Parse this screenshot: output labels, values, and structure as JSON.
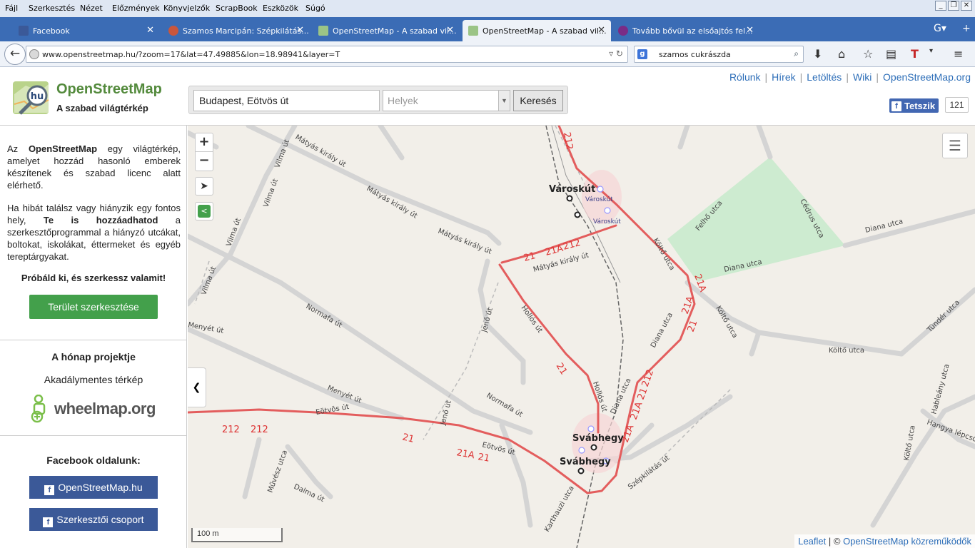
{
  "browser": {
    "menu": [
      {
        "label": "Fájl"
      },
      {
        "label": "Szerkesztés"
      },
      {
        "label": "Nézet"
      },
      {
        "label": "Előzmények"
      },
      {
        "label": "Könyvjelzők"
      },
      {
        "label": "ScrapBook"
      },
      {
        "label": "Eszközök"
      },
      {
        "label": "Súgó"
      }
    ],
    "tabs": [
      {
        "label": "Facebook",
        "icon": "facebook-icon",
        "active": false
      },
      {
        "label": "Szamos Marcipán: Szépkilátás...",
        "icon": "szamos-icon",
        "active": false
      },
      {
        "label": "OpenStreetMap - A szabad vil...",
        "icon": "osm-icon",
        "active": false
      },
      {
        "label": "OpenStreetMap - A szabad vil...",
        "icon": "osm-icon",
        "active": true
      },
      {
        "label": "Tovább bővül az elsőajtós fel...",
        "icon": "generic-page-icon",
        "active": false
      }
    ],
    "url": "www.openstreetmap.hu/?zoom=17&lat=47.49885&lon=18.98941&layer=T",
    "search_engine_letter": "g",
    "search_value": "szamos cukrászda",
    "win_controls": [
      "_",
      "❐",
      "✕"
    ]
  },
  "header": {
    "logo_badge": "hu",
    "title": "OpenStreetMap",
    "subtitle": "A szabad világtérkép",
    "search_value": "Budapest, Eötvös út",
    "places_placeholder": "Helyek",
    "search_button": "Keresés",
    "links": [
      "Rólunk",
      "Hírek",
      "Letöltés",
      "Wiki",
      "OpenStreetMap.org"
    ],
    "fb_like": "Tetszik",
    "fb_count": "121"
  },
  "sidebar": {
    "intro1_pre": "Az ",
    "intro1_bold": "OpenStreetMap",
    "intro1_post": " egy világtérkép, amelyet hozzád hasonló emberek készítenek és szabad licenc alatt elérhető.",
    "intro2_pre": "Ha hibát találsz vagy hiányzik egy fontos hely, ",
    "intro2_bold": "Te is hozzáadhatod",
    "intro2_post": " a szerkesztőprogrammal a hiányzó utcákat, boltokat, iskolákat, éttermeket és egyéb tereptárgyakat.",
    "try_it": "Próbáld ki, és szerkessz valamit!",
    "edit_button": "Terület szerkesztése",
    "project_title": "A hónap projektje",
    "project_name": "Akadálymentes térkép",
    "wheelmap": "wheelmap.org",
    "fb_title": "Facebook oldalunk:",
    "fb_buttons": [
      "OpenStreetMap.hu",
      "Szerkesztői csoport"
    ]
  },
  "map": {
    "zoom_in": "+",
    "zoom_out": "−",
    "scale": "100 m",
    "attrib_leaflet": "Leaflet",
    "attrib_sep": " | © ",
    "attrib_osm": "OpenStreetMap közreműködők",
    "streets": [
      "Mátyás király út",
      "Mátyás király út",
      "Mátyás király út",
      "Mátyás király út",
      "Vilma út",
      "Vilma út",
      "Vilma út",
      "Vilma út",
      "Normafa út",
      "Normafa út",
      "Menyét út",
      "Menyét út",
      "Eötvös út",
      "Eötvös út",
      "Hollós út",
      "Hollós út",
      "Jenő út",
      "Jenő út",
      "Diana utca",
      "Diana utca",
      "Diana utca",
      "Diana utca",
      "Felhő utca",
      "Cédrus utca",
      "Költő utca",
      "Költő utca",
      "Költő utca",
      "Költő utca",
      "Tündér utca",
      "Hableány utca",
      "Hangya lépcső",
      "Szépkilátás út",
      "Művész utca",
      "Dalma út",
      "Karthauzi utca"
    ],
    "routes": [
      "212",
      "21",
      "21A",
      "212",
      "21",
      "21A",
      "21A",
      "21",
      "212",
      "212",
      "21",
      "21A",
      "21",
      "21A",
      "21A",
      "21",
      "212",
      "212"
    ],
    "stops": [
      "Városkút",
      "Városkút",
      "Városkút",
      "Svábhegy",
      "Svábhegy"
    ]
  }
}
